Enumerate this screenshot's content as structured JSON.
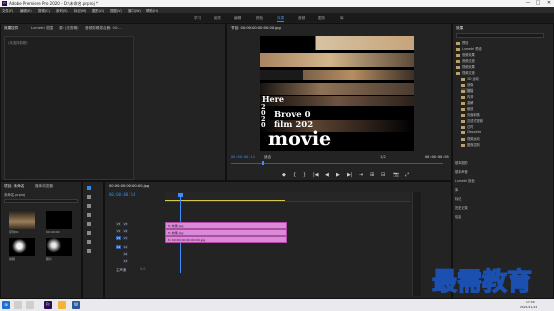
{
  "titlebar": {
    "app_icon": "Pr",
    "title": "Adobe Premiere Pro 2020 - D:\\未命名.prproj *",
    "min": "—",
    "max": "□",
    "close": "✕"
  },
  "menu": [
    "文件(F)",
    "编辑(E)",
    "剪辑(C)",
    "序列(S)",
    "标记(M)",
    "图形(G)",
    "视图(V)",
    "窗口(W)",
    "帮助(H)"
  ],
  "workspaces": [
    "学习",
    "组件",
    "编辑",
    "颜色",
    "效果",
    "音频",
    "图形",
    "库"
  ],
  "active_workspace": "效果",
  "source_panel": {
    "tabs": [
      "效果控件",
      "Lumetri 范围",
      "源: (无剪辑)",
      "音频剪辑混合器: 00:..."
    ],
    "label": "(未选择剪辑)"
  },
  "program": {
    "tab": "节目: 00:00:00:00:00:00.jpg",
    "video_text": {
      "here": "Here",
      "year": "2020",
      "line1": "Brove 0",
      "line2": "film 202",
      "movie": "movie"
    },
    "timecode": "00:00:00:14",
    "fit": "适合",
    "ratio": "1/2",
    "end_timecode": "00:00:00:05",
    "controls": [
      "◆",
      "{",
      "}",
      "|◀",
      "◀",
      "▶",
      "▶|",
      "⇥",
      "⊞",
      "⊟",
      "📷",
      "⤢"
    ]
  },
  "effects": {
    "tab": "效果",
    "tree": [
      "预设",
      "Lumetri 预设",
      "音频效果",
      "音频过渡",
      "视频效果",
      "视频过渡",
      "3D 运动",
      "划像",
      "擦除",
      "内滑",
      "溶解",
      "缩放",
      "页面剥落",
      "沉浸式视频",
      "过时",
      "Obsolete",
      "视频运动",
      "图像控制"
    ],
    "lower": [
      "基本图形",
      "基本声音",
      "Lumetri 颜色",
      "库",
      "标记",
      "历史记录",
      "信息"
    ]
  },
  "project": {
    "tabs": [
      "项目: 未命名",
      "媒体浏览器"
    ],
    "file": "未命名.prproj",
    "thumbs": [
      "序列01",
      "00:00:00",
      "剪辑",
      "照片"
    ]
  },
  "timeline": {
    "tab": "00:00:00:00:00:00.jpg",
    "timecode": "00:00:00:14",
    "tracks": [
      "V3",
      "V2",
      "V1",
      "A1",
      "A2",
      "A3"
    ],
    "master": "主声道",
    "master_val": "0.0",
    "clips": [
      {
        "label": "fx 效果.jpg"
      },
      {
        "label": "fx 效果.jpg"
      },
      {
        "label": "fx 00:00:00:00:00:00.jpg"
      }
    ]
  },
  "taskbar": {
    "time": "17:00",
    "date": "2021/11/12"
  },
  "watermark": "最需教育",
  "colors": {
    "accent": "#2d8ceb",
    "clip": "#d98bd6",
    "playhead": "#3f8cff"
  }
}
